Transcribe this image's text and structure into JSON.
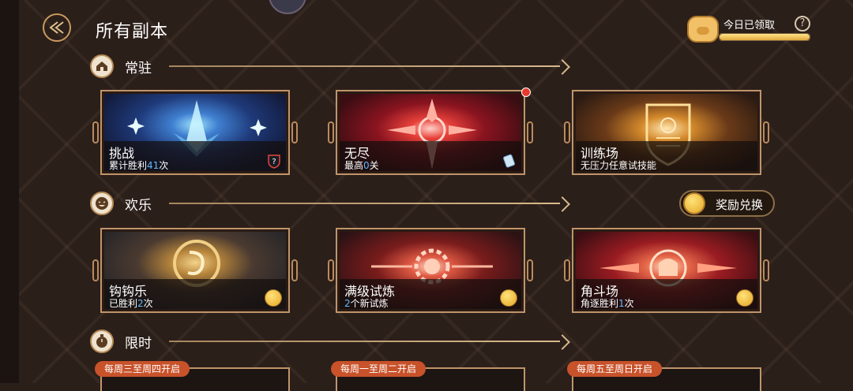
{
  "header": {
    "title": "所有副本",
    "daily_label": "今日已领取",
    "daily_progress": 1.0,
    "help_label": "?"
  },
  "sections": [
    {
      "title": "常驻"
    },
    {
      "title": "欢乐"
    },
    {
      "title": "限时"
    }
  ],
  "exchange_button": {
    "label": "奖励兑换"
  },
  "cards": {
    "permanent": [
      {
        "name": "挑战",
        "sub_prefix": "累计胜利",
        "sub_value": "41",
        "sub_suffix": "次",
        "badge": "question-shield-icon"
      },
      {
        "name": "无尽",
        "sub_prefix": "最高",
        "sub_value": "0",
        "sub_suffix": "关",
        "badge": "scroll-icon"
      },
      {
        "name": "训练场",
        "sub_prefix": "无压力任意试技能",
        "sub_value": "",
        "sub_suffix": "",
        "badge": ""
      }
    ],
    "fun": [
      {
        "name": "钩钩乐",
        "sub_prefix": "已胜利",
        "sub_value": "2",
        "sub_suffix": "次",
        "badge": "smiley-icon"
      },
      {
        "name": "满级试炼",
        "sub_prefix": "",
        "sub_value": "2",
        "sub_suffix": "个新试炼",
        "badge": "smiley-icon"
      },
      {
        "name": "角斗场",
        "sub_prefix": "角逐胜利",
        "sub_value": "1",
        "sub_suffix": "次",
        "badge": "smiley-icon"
      }
    ],
    "limited_tags": [
      "每周三至周四开启",
      "每周一至周二开启",
      "每周五至周日开启"
    ]
  },
  "colors": {
    "accent_blue": "#5fb8ff",
    "tag_orange": "#c8522a",
    "frame_gold": "#c0946a"
  }
}
